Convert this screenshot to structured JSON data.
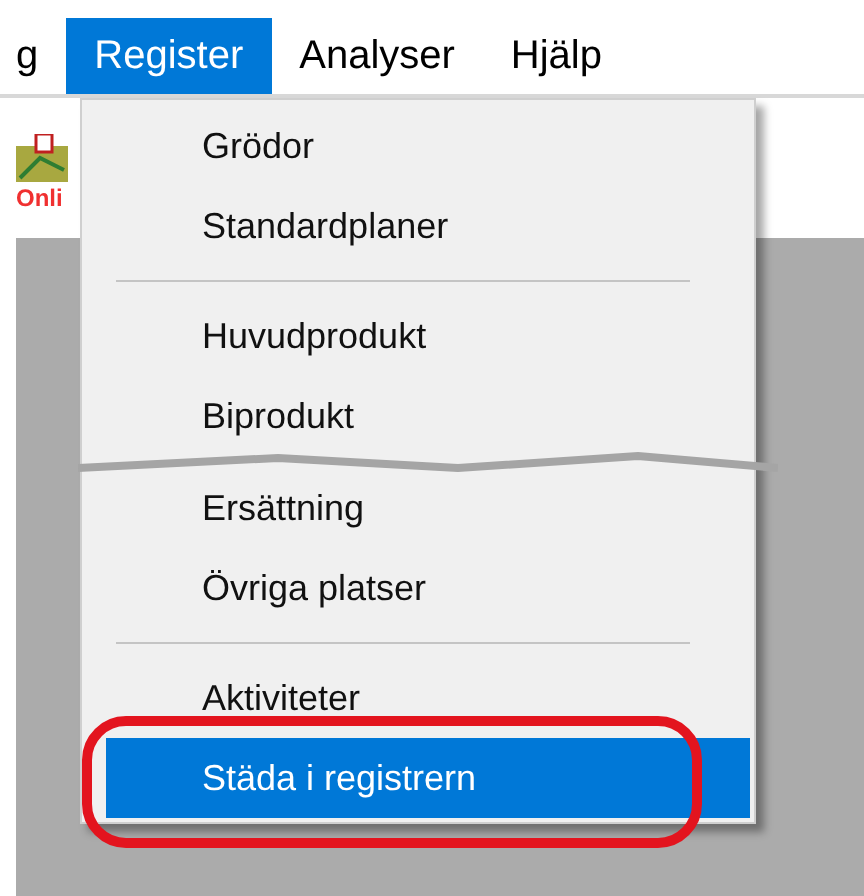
{
  "menubar": [
    {
      "label": "g",
      "selected": false
    },
    {
      "label": "Register",
      "selected": true
    },
    {
      "label": "Analyser",
      "selected": false
    },
    {
      "label": "Hjälp",
      "selected": false
    }
  ],
  "toolbar": [
    {
      "label": "Onli"
    }
  ],
  "menu": [
    {
      "kind": "item",
      "label": "Grödor",
      "selected": false,
      "circled": false
    },
    {
      "kind": "item",
      "label": "Standardplaner",
      "selected": false,
      "circled": false
    },
    {
      "kind": "separator"
    },
    {
      "kind": "item",
      "label": "Huvudprodukt",
      "selected": false,
      "circled": false
    },
    {
      "kind": "item",
      "label": "Biprodukt",
      "selected": false,
      "circled": false
    },
    {
      "kind": "tear"
    },
    {
      "kind": "item",
      "label": "Ersättning",
      "selected": false,
      "circled": false
    },
    {
      "kind": "item",
      "label": "Övriga platser",
      "selected": false,
      "circled": false
    },
    {
      "kind": "separator"
    },
    {
      "kind": "item",
      "label": "Aktiviteter",
      "selected": false,
      "circled": false
    },
    {
      "kind": "item",
      "label": "Städa i registrern",
      "selected": true,
      "circled": true
    }
  ]
}
